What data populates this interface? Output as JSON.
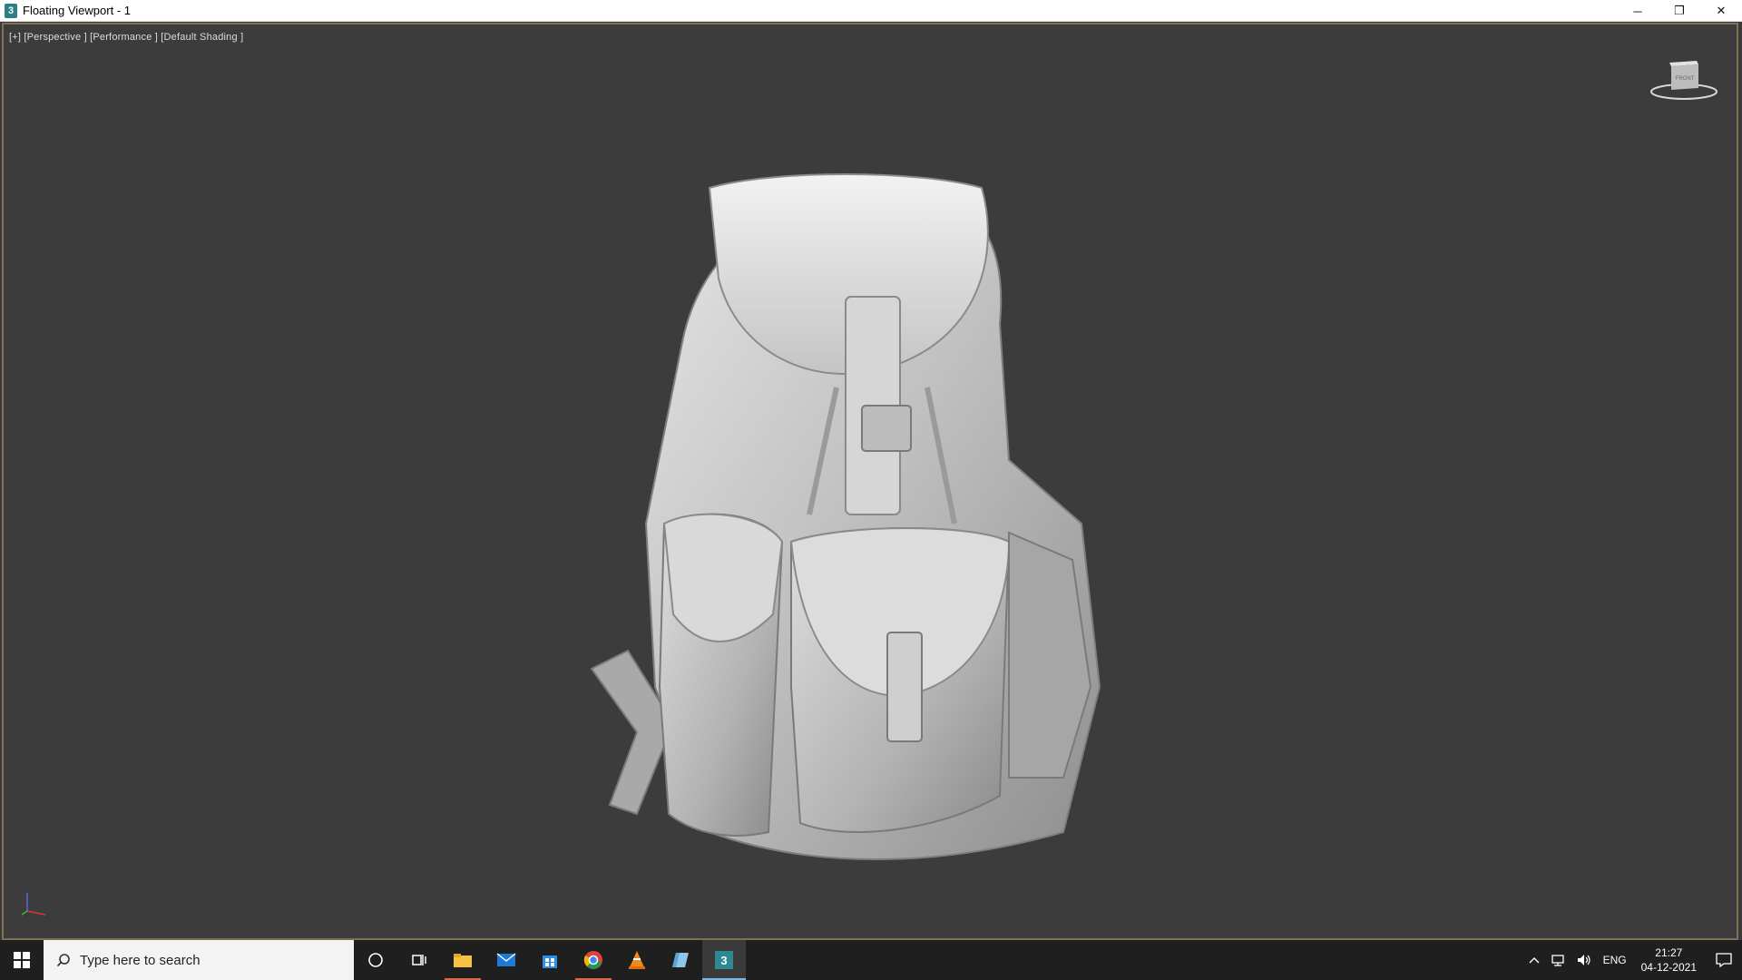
{
  "window": {
    "title": "Floating Viewport - 1",
    "app_icon_label": "3",
    "controls": {
      "minimize": "─",
      "restore": "❐",
      "close": "✕"
    }
  },
  "viewport": {
    "label": "[+] [Perspective ] [Performance ] [Default Shading ]",
    "viewcube_label": "FRONT",
    "object": "backpack"
  },
  "taskbar": {
    "search_placeholder": "Type here to search",
    "apps": [
      {
        "name": "cortana",
        "icon": "circle-icon"
      },
      {
        "name": "task-view",
        "icon": "task-view-icon"
      },
      {
        "name": "file-explorer",
        "icon": "folder-icon",
        "state": "active"
      },
      {
        "name": "mail",
        "icon": "mail-icon"
      },
      {
        "name": "store",
        "icon": "store-icon"
      },
      {
        "name": "chrome",
        "icon": "chrome-icon",
        "state": "active"
      },
      {
        "name": "vlc",
        "icon": "vlc-icon"
      },
      {
        "name": "app",
        "icon": "blue-app-icon"
      },
      {
        "name": "3ds-max",
        "icon": "3dsmax-icon",
        "label": "3",
        "state": "current"
      }
    ],
    "tray": {
      "language": "ENG",
      "time": "21:27",
      "date": "04-12-2021"
    }
  },
  "colors": {
    "viewport_bg": "#3c3c3c",
    "viewport_border": "#7d7256",
    "taskbar_bg": "#1f1f1f",
    "model": "#c9c9c9"
  }
}
